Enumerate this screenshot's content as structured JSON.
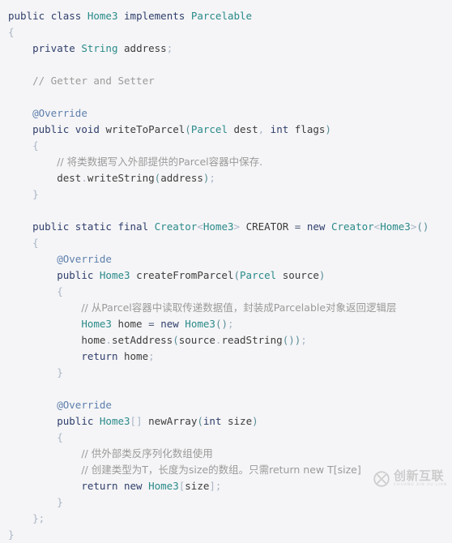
{
  "editor": {
    "background_color": "#f5f5f7",
    "language": "java",
    "theme_colors": {
      "keyword": "#2f3e6b",
      "type": "#2a8a89",
      "annotation": "#5d7fad",
      "comment": "#9a9a9a",
      "punctuation": "#a9b5c6",
      "paren": "#578c96",
      "identifier": "#3c3c3c",
      "operator": "#4a5a78"
    },
    "lines": [
      {
        "n": 1,
        "text": "public class Home3 implements Parcelable"
      },
      {
        "n": 2,
        "text": "{"
      },
      {
        "n": 3,
        "text": "    private String address;"
      },
      {
        "n": 4,
        "text": ""
      },
      {
        "n": 5,
        "text": "    // Getter and Setter"
      },
      {
        "n": 6,
        "text": ""
      },
      {
        "n": 7,
        "text": "    @Override"
      },
      {
        "n": 8,
        "text": "    public void writeToParcel(Parcel dest, int flags)"
      },
      {
        "n": 9,
        "text": "    {"
      },
      {
        "n": 10,
        "text": "        // 将类数据写入外部提供的Parcel容器中保存."
      },
      {
        "n": 11,
        "text": "        dest.writeString(address);"
      },
      {
        "n": 12,
        "text": "    }"
      },
      {
        "n": 13,
        "text": ""
      },
      {
        "n": 14,
        "text": "    public static final Creator<Home3> CREATOR = new Creator<Home3>()"
      },
      {
        "n": 15,
        "text": "    {"
      },
      {
        "n": 16,
        "text": "        @Override"
      },
      {
        "n": 17,
        "text": "        public Home3 createFromParcel(Parcel source)"
      },
      {
        "n": 18,
        "text": "        {"
      },
      {
        "n": 19,
        "text": "            // 从Parcel容器中读取传递数据值，封装成Parcelable对象返回逻辑层"
      },
      {
        "n": 20,
        "text": "            Home3 home = new Home3();"
      },
      {
        "n": 21,
        "text": "            home.setAddress(source.readString());"
      },
      {
        "n": 22,
        "text": "            return home;"
      },
      {
        "n": 23,
        "text": "        }"
      },
      {
        "n": 24,
        "text": ""
      },
      {
        "n": 25,
        "text": "        @Override"
      },
      {
        "n": 26,
        "text": "        public Home3[] newArray(int size)"
      },
      {
        "n": 27,
        "text": "        {"
      },
      {
        "n": 28,
        "text": "            // 供外部类反序列化数组使用"
      },
      {
        "n": 29,
        "text": "            // 创建类型为T，长度为size的数组。只需return new T[size]"
      },
      {
        "n": 30,
        "text": "            return new Home3[size];"
      },
      {
        "n": 31,
        "text": "        }"
      },
      {
        "n": 32,
        "text": "    };"
      },
      {
        "n": 33,
        "text": "}"
      }
    ]
  },
  "watermark": {
    "logo_icon": "circled-x-logo-icon",
    "name_cn": "创新互联",
    "name_en": "CHUANG XIN HU LIAN",
    "color": "#9c9c9c"
  }
}
